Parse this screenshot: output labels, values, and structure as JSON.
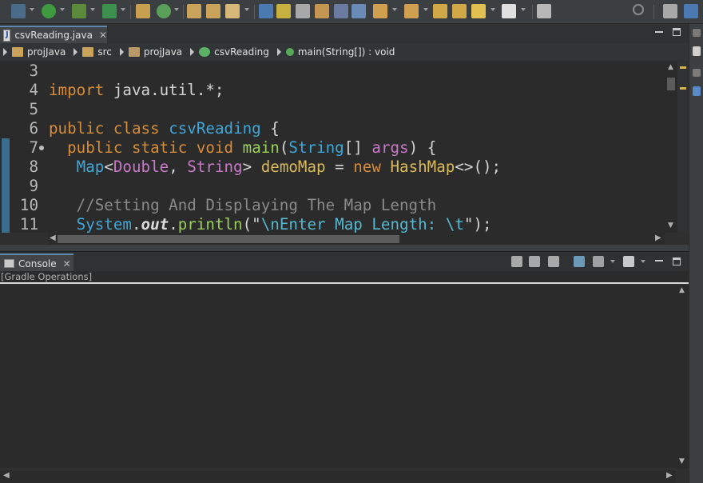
{
  "editor": {
    "tab_title": "csvReading.java",
    "lines": [
      {
        "num": "3",
        "segments": []
      },
      {
        "num": "4",
        "segments": [
          {
            "t": "import",
            "c": "kw"
          },
          {
            "t": " java.util.*;",
            "c": ""
          }
        ]
      },
      {
        "num": "5",
        "segments": []
      },
      {
        "num": "6",
        "segments": [
          {
            "t": "public",
            "c": "kw"
          },
          {
            "t": " ",
            "c": ""
          },
          {
            "t": "class",
            "c": "kw"
          },
          {
            "t": " ",
            "c": ""
          },
          {
            "t": "csvReading",
            "c": "cls"
          },
          {
            "t": " {",
            "c": ""
          }
        ]
      },
      {
        "num": "7",
        "fold": true,
        "segments": [
          {
            "t": "  ",
            "c": ""
          },
          {
            "t": "public",
            "c": "kw"
          },
          {
            "t": " ",
            "c": ""
          },
          {
            "t": "static",
            "c": "kw"
          },
          {
            "t": " ",
            "c": ""
          },
          {
            "t": "void",
            "c": "kw"
          },
          {
            "t": " ",
            "c": ""
          },
          {
            "t": "main",
            "c": "fn"
          },
          {
            "t": "(",
            "c": ""
          },
          {
            "t": "String",
            "c": "cls"
          },
          {
            "t": "[] ",
            "c": ""
          },
          {
            "t": "args",
            "c": "type"
          },
          {
            "t": ") {",
            "c": ""
          }
        ]
      },
      {
        "num": "8",
        "segments": [
          {
            "t": "   ",
            "c": ""
          },
          {
            "t": "Map",
            "c": "cls"
          },
          {
            "t": "<",
            "c": ""
          },
          {
            "t": "Double",
            "c": "type"
          },
          {
            "t": ", ",
            "c": ""
          },
          {
            "t": "String",
            "c": "type"
          },
          {
            "t": "> ",
            "c": ""
          },
          {
            "t": "demoMap",
            "c": "var"
          },
          {
            "t": " = ",
            "c": ""
          },
          {
            "t": "new",
            "c": "kw"
          },
          {
            "t": " ",
            "c": ""
          },
          {
            "t": "HashMap",
            "c": "var"
          },
          {
            "t": "<>();",
            "c": ""
          }
        ]
      },
      {
        "num": "9",
        "segments": []
      },
      {
        "num": "10",
        "segments": [
          {
            "t": "   ",
            "c": ""
          },
          {
            "t": "//Setting And Displaying The Map Length",
            "c": "cmt"
          }
        ]
      },
      {
        "num": "11",
        "segments": [
          {
            "t": "   ",
            "c": ""
          },
          {
            "t": "System",
            "c": "cls"
          },
          {
            "t": ".",
            "c": ""
          },
          {
            "t": "out",
            "c": "field"
          },
          {
            "t": ".",
            "c": ""
          },
          {
            "t": "println",
            "c": "fn"
          },
          {
            "t": "(\"",
            "c": ""
          },
          {
            "t": "\\nEnter Map Length: \\t",
            "c": "str"
          },
          {
            "t": "\");",
            "c": ""
          }
        ]
      }
    ]
  },
  "breadcrumb": [
    "projJava",
    "src",
    "projJava",
    "csvReading",
    "main(String[]) : void"
  ],
  "console": {
    "tab_title": "Console",
    "label": "[Gradle Operations]"
  },
  "colors": {
    "background": "#2b2b2b",
    "keyword": "#d68d3a",
    "class": "#3fa7d8",
    "comment": "#8a8a8a",
    "accent": "#5d88b0"
  }
}
